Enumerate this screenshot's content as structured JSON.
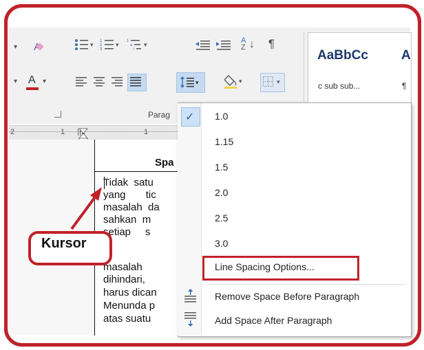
{
  "styles": {
    "sample_1": "AaBbCc",
    "sample_2": "A",
    "name_1": "c sub sub...",
    "name_2": "¶"
  },
  "ribbon": {
    "group_label": "Parag",
    "sort_icon": "A↓Z",
    "pilcrow": "¶"
  },
  "ruler": {
    "n1": "2",
    "n2": "1",
    "n3": "1"
  },
  "document": {
    "heading": "Spa",
    "lines": [
      "Tidak  satu",
      "yang       tic",
      "masalah  da",
      "sahkan  m",
      "setiap     s",
      "masalah",
      "dihindari,",
      "harus dican",
      "Menunda p",
      "atas suatu"
    ],
    "right_letters": [
      "p",
      "i",
      "t"
    ]
  },
  "line_spacing_menu": {
    "options": [
      "1.0",
      "1.15",
      "1.5",
      "2.0",
      "2.5",
      "3.0"
    ],
    "selected": "1.0",
    "line_spacing_options": "Line Spacing Options...",
    "remove_space_before": "Remove Space Before Paragraph",
    "add_space_after": "Add Space After Paragraph"
  },
  "callout": {
    "label": "Kursor",
    "color": "#c0222a"
  },
  "icons": [
    "bullets-icon",
    "numbering-icon",
    "multilevel-list-icon",
    "decrease-indent-icon",
    "increase-indent-icon",
    "sort-icon",
    "show-formatting-icon",
    "font-color-icon",
    "align-left-icon",
    "align-center-icon",
    "align-right-icon",
    "justify-icon",
    "line-spacing-icon",
    "shading-icon",
    "borders-icon"
  ]
}
